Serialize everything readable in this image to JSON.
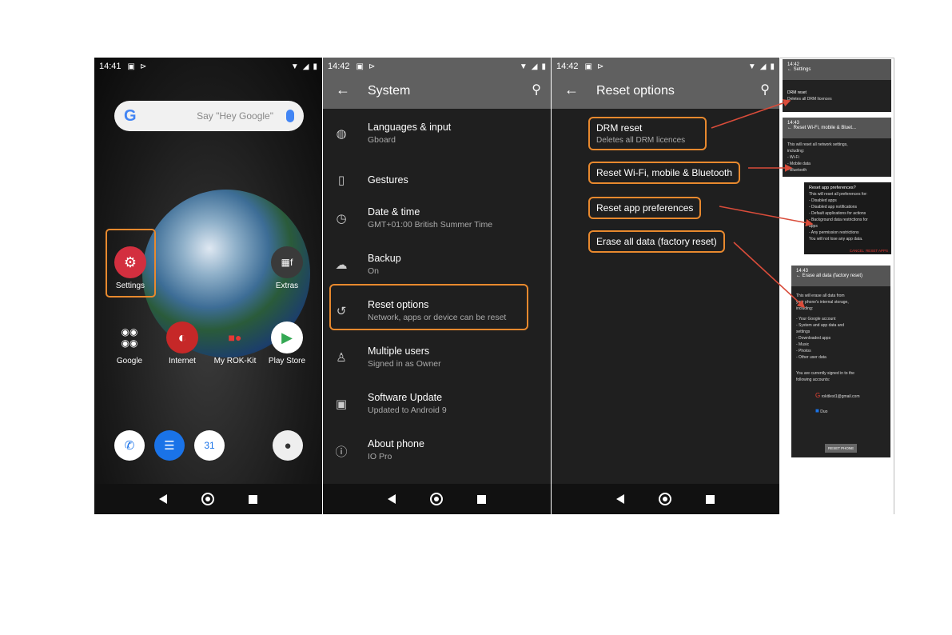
{
  "home": {
    "time": "14:41",
    "search_placeholder": "Say \"Hey Google\"",
    "search_logo": "G",
    "apps": [
      {
        "label": "Settings",
        "icon": "gear-icon"
      },
      {
        "label": "Extras",
        "icon": "folder-icon"
      },
      {
        "label": "Google",
        "icon": "google-folder-icon"
      },
      {
        "label": "Internet",
        "icon": "browser-icon"
      },
      {
        "label": "My ROK-Kit",
        "icon": "rok-kit-icon"
      },
      {
        "label": "Play Store",
        "icon": "play-store-icon"
      }
    ],
    "calendar_day": "31"
  },
  "system": {
    "time": "14:42",
    "title": "System",
    "items": [
      {
        "title": "Languages & input",
        "subtitle": "Gboard",
        "icon": "globe-icon"
      },
      {
        "title": "Gestures",
        "subtitle": "",
        "icon": "gestures-icon"
      },
      {
        "title": "Date & time",
        "subtitle": "GMT+01:00 British Summer Time",
        "icon": "clock-icon"
      },
      {
        "title": "Backup",
        "subtitle": "On",
        "icon": "backup-icon"
      },
      {
        "title": "Reset options",
        "subtitle": "Network, apps or device can be reset",
        "icon": "reset-icon"
      },
      {
        "title": "Multiple users",
        "subtitle": "Signed in as Owner",
        "icon": "person-icon"
      },
      {
        "title": "Software Update",
        "subtitle": "Updated to Android 9",
        "icon": "update-icon"
      },
      {
        "title": "About phone",
        "subtitle": "IO Pro",
        "icon": "info-icon"
      }
    ]
  },
  "reset": {
    "time": "14:42",
    "title": "Reset options",
    "options": [
      {
        "title": "DRM reset",
        "subtitle": "Deletes all DRM licences"
      },
      {
        "title": "Reset Wi-Fi, mobile & Bluetooth",
        "subtitle": ""
      },
      {
        "title": "Reset app preferences",
        "subtitle": ""
      },
      {
        "title": "Erase all data (factory reset)",
        "subtitle": ""
      }
    ]
  },
  "thumbs": {
    "t1": {
      "time": "14:42",
      "title": "Settings",
      "line1": "DRM reset",
      "line2": "Deletes all DRM licences"
    },
    "t2": {
      "time": "14:43",
      "title": "Reset Wi-Fi, mobile & Bluet...",
      "lines": [
        "This will reset all network settings,",
        "including:",
        "",
        "- Wi-Fi",
        "- Mobile data",
        "- Bluetooth"
      ]
    },
    "t3": {
      "title": "Reset app preferences?",
      "lines": [
        "This will reset all preferences for:",
        "",
        "- Disabled apps",
        "- Disabled app notifications",
        "- Default applications for actions",
        "- Background data restrictions for",
        "  apps",
        "- Any permission restrictions",
        "",
        "You will not lose any app data."
      ],
      "cancel": "CANCEL",
      "confirm": "RESET APPS"
    },
    "t4": {
      "time": "14:43",
      "title": "Erase all data (factory reset)",
      "lines": [
        "This will erase all data from",
        "your phone's internal storage,",
        "including:",
        "",
        "- Your Google account",
        "- System and app data and",
        "  settings",
        "- Downloaded apps",
        "- Music",
        "- Photos",
        "- Other user data",
        "",
        "You are currently signed in to the",
        "following accounts:"
      ],
      "account1": "rokitlest1@gmail.com",
      "account2": "Duo",
      "button": "RESET PHONE"
    }
  }
}
